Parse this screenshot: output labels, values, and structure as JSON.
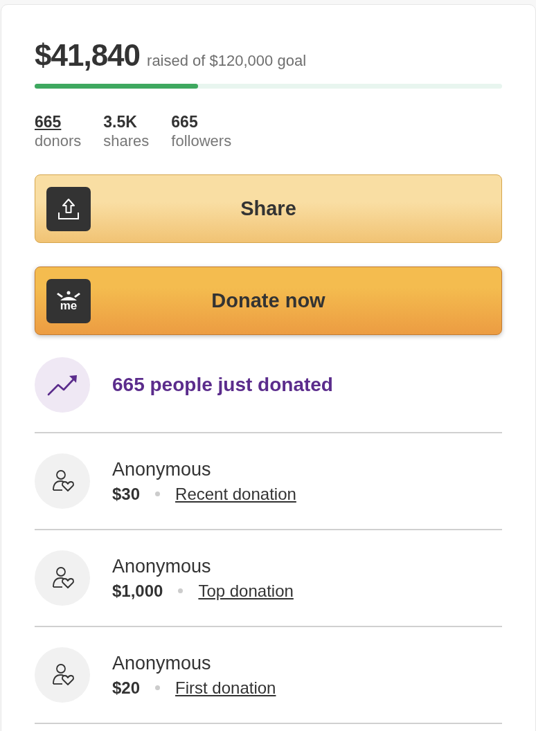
{
  "amount": "$41,840",
  "goal_text": "raised of $120,000 goal",
  "progress": {
    "level": 0.35
  },
  "stats": [
    {
      "value": "665",
      "label": "donors",
      "link": true
    },
    {
      "value": "3.5K",
      "label": "shares",
      "link": false
    },
    {
      "value": "665",
      "label": "followers",
      "link": false
    }
  ],
  "buttons": [
    {
      "kind": "share",
      "label": "Share"
    },
    {
      "kind": "donate",
      "label": "Donate now",
      "logo_text": "me"
    }
  ],
  "trending": {
    "text": "665 people just donated"
  },
  "donations": [
    {
      "name": "Anonymous",
      "amount": "$30",
      "tag": "Recent donation"
    },
    {
      "name": "Anonymous",
      "amount": "$1,000",
      "tag": "Top donation"
    },
    {
      "name": "Anonymous",
      "amount": "$20",
      "tag": "First donation"
    }
  ]
}
